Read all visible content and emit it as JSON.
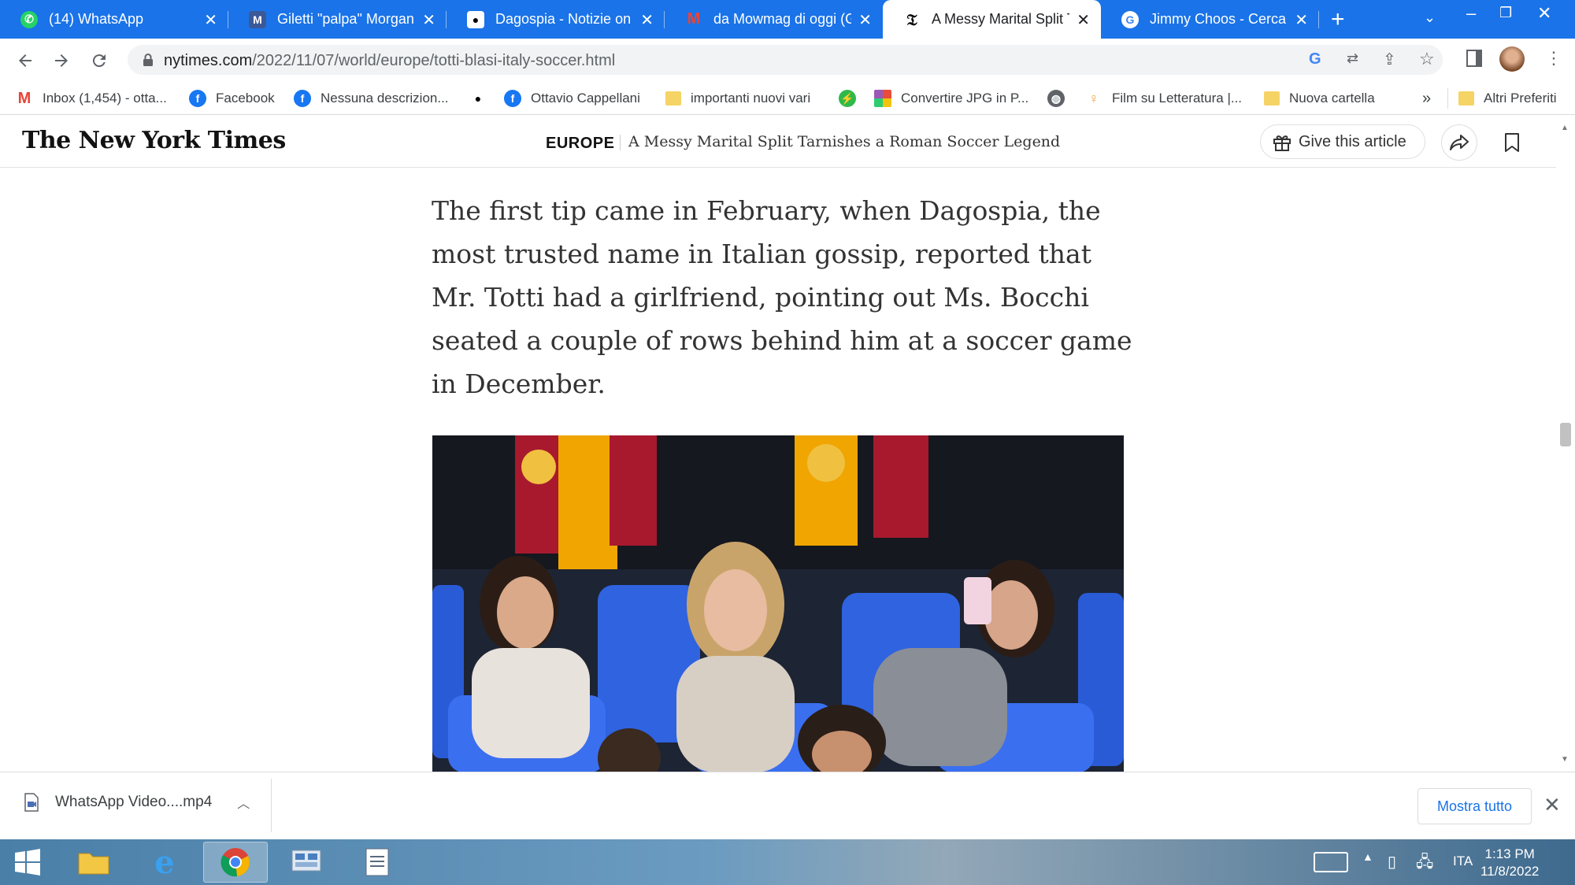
{
  "tabs": [
    {
      "title": "(14) WhatsApp",
      "icon": "whatsapp-icon",
      "color": "#25d366"
    },
    {
      "title": "Giletti \"palpa\" Morgan e",
      "icon": "mowmag-icon",
      "color": "#3b5998"
    },
    {
      "title": "Dagospia - Notizie on line",
      "icon": "dagospia-icon",
      "color": "#ffffff"
    },
    {
      "title": "da Mowmag di oggi (G",
      "icon": "gmail-icon",
      "color": "#ea4335"
    },
    {
      "title": "A Messy Marital Split Ta",
      "icon": "nyt-icon",
      "color": "#000000"
    },
    {
      "title": "Jimmy Choos - Cerca co",
      "icon": "google-icon",
      "color": "#4285f4"
    }
  ],
  "toolbar": {
    "url_host": "nytimes.com",
    "url_path": "/2022/11/07/world/europe/totti-blasi-italy-soccer.html"
  },
  "bookmarks": [
    {
      "label": "Inbox (1,454) - otta...",
      "icon": "gmail-icon"
    },
    {
      "label": "Facebook",
      "icon": "facebook-icon"
    },
    {
      "label": "Nessuna descrizion...",
      "icon": "facebook-icon"
    },
    {
      "label": "",
      "icon": "dagospia-icon"
    },
    {
      "label": "Ottavio Cappellani",
      "icon": "facebook-icon"
    },
    {
      "label": "importanti nuovi vari",
      "icon": "folder-icon"
    },
    {
      "label": "",
      "icon": "green-icon"
    },
    {
      "label": "Convertire JPG in P...",
      "icon": "grid-icon"
    },
    {
      "label": "",
      "icon": "globe-icon"
    },
    {
      "label": "Film su Letteratura |...",
      "icon": "pin-icon"
    },
    {
      "label": "Nuova cartella",
      "icon": "folder-icon"
    }
  ],
  "bookmarks_more": "»",
  "bookmarks_other": "Altri Preferiti",
  "nyt": {
    "logo": "The New York Times",
    "section": "EUROPE",
    "headline": "A Messy Marital Split Tarnishes a Roman Soccer Legend",
    "gift_label": "Give this article"
  },
  "article": {
    "paragraph": "The first tip came in February, when Dagospia, the most trusted name in Italian gossip, reported that Mr. Totti had a girlfriend, pointing out Ms. Bocchi seated a couple of rows behind him at a soccer game in December."
  },
  "downloads": {
    "file": "WhatsApp Video....mp4",
    "show_all": "Mostra tutto"
  },
  "taskbar": {
    "lang": "ITA",
    "time": "1:13 PM",
    "date": "11/8/2022"
  }
}
